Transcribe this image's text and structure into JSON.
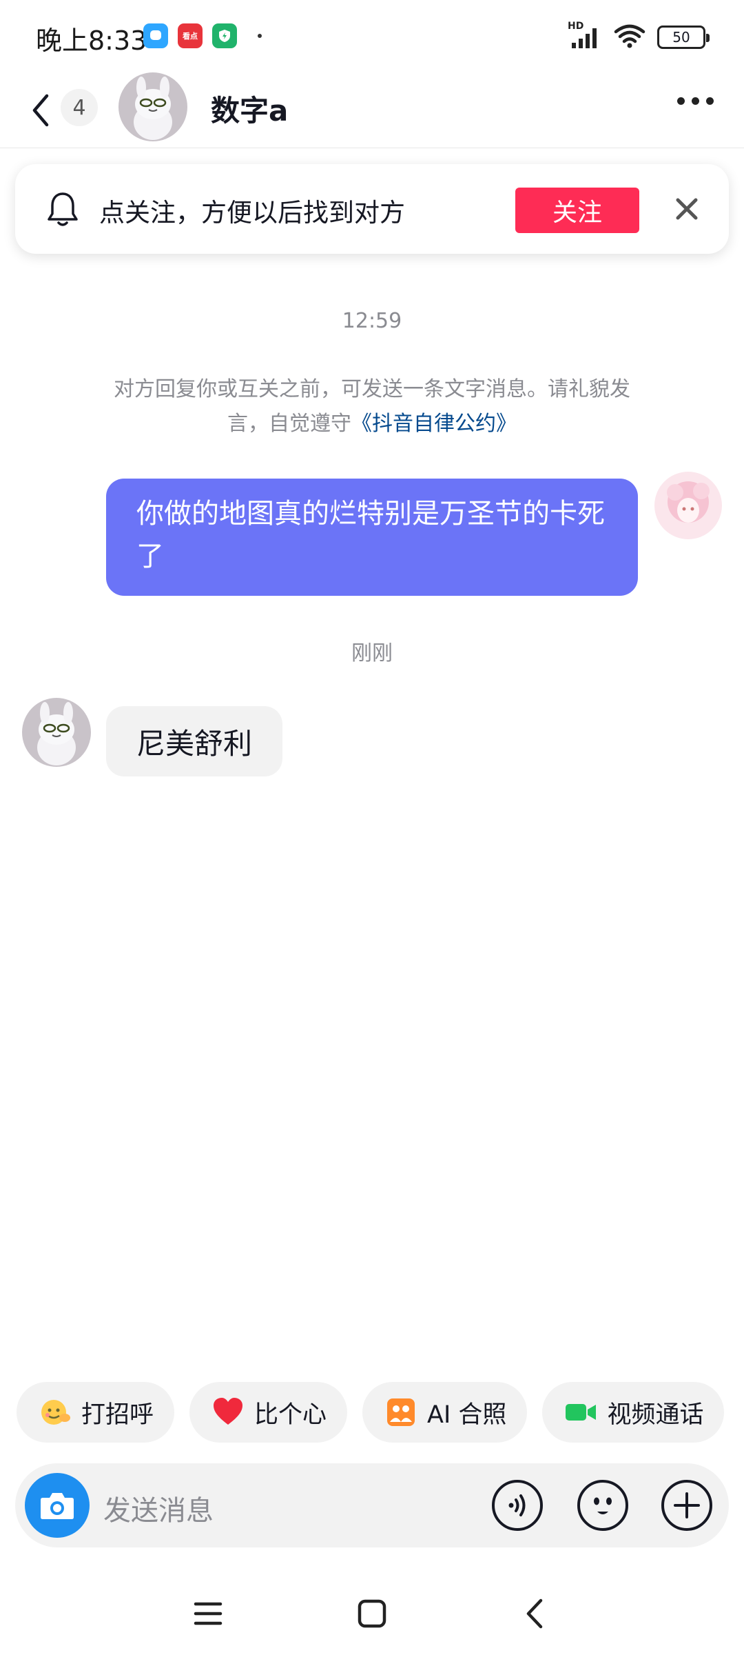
{
  "status_bar": {
    "time": "晚上8:33",
    "notif_icons": [
      "chat-bubble-icon",
      "kandian-app-icon",
      "shield-app-icon"
    ],
    "notif_badge_text": "看点",
    "network": "HD",
    "battery": "50"
  },
  "header": {
    "unread_count": "4",
    "contact_name": "数字a"
  },
  "follow_banner": {
    "text": "点关注，方便以后找到对方",
    "follow_label": "关注"
  },
  "messages": {
    "time_1": "12:59",
    "notice_text": "对方回复你或互关之前，可发送一条文字消息。请礼貌发言，自觉遵守",
    "notice_link": "《抖音自律公约》",
    "outgoing_text": "你做的地图真的烂特别是万圣节的卡死了",
    "time_2": "刚刚",
    "incoming_text": "尼美舒利"
  },
  "quick_actions": [
    {
      "label": "打招呼",
      "icon": "wave-emoji-icon"
    },
    {
      "label": "比个心",
      "icon": "heart-icon"
    },
    {
      "label": "AI 合照",
      "icon": "ai-photo-icon"
    },
    {
      "label": "视频通话",
      "icon": "video-camera-icon"
    }
  ],
  "input_bar": {
    "placeholder": "发送消息"
  },
  "colors": {
    "accent_red": "#fe2c55",
    "outgoing_bubble": "#6b74f7",
    "camera_blue": "#1e8ff0",
    "link_blue": "#04498d"
  }
}
